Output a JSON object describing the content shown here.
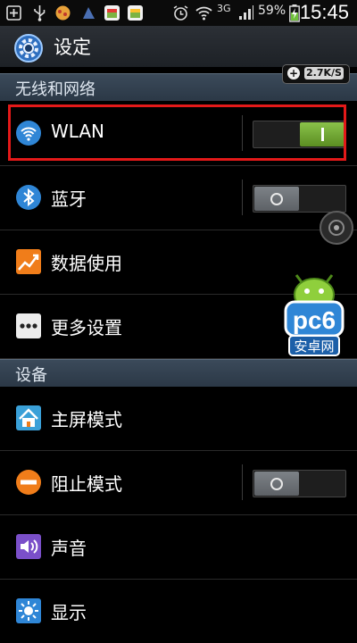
{
  "status_bar": {
    "network_type": "3G",
    "battery": "59%",
    "time": "15:45"
  },
  "action_bar": {
    "title": "设定"
  },
  "speed_indicator": {
    "value": "2.7K/S"
  },
  "sections": {
    "wireless": "无线和网络",
    "device": "设备"
  },
  "items": [
    {
      "label": "WLAN",
      "toggle": "on"
    },
    {
      "label": "蓝牙",
      "toggle": "off"
    },
    {
      "label": "数据使用"
    },
    {
      "label": "更多设置"
    },
    {
      "label": "主屏模式"
    },
    {
      "label": "阻止模式",
      "toggle": "off"
    },
    {
      "label": "声音"
    },
    {
      "label": "显示"
    }
  ],
  "watermark": {
    "brand": "pc6",
    "sub": "安卓网"
  },
  "colors": {
    "highlight": "#e31919",
    "toggle_on": "#7bb33c",
    "section_bg": "#34414f"
  }
}
